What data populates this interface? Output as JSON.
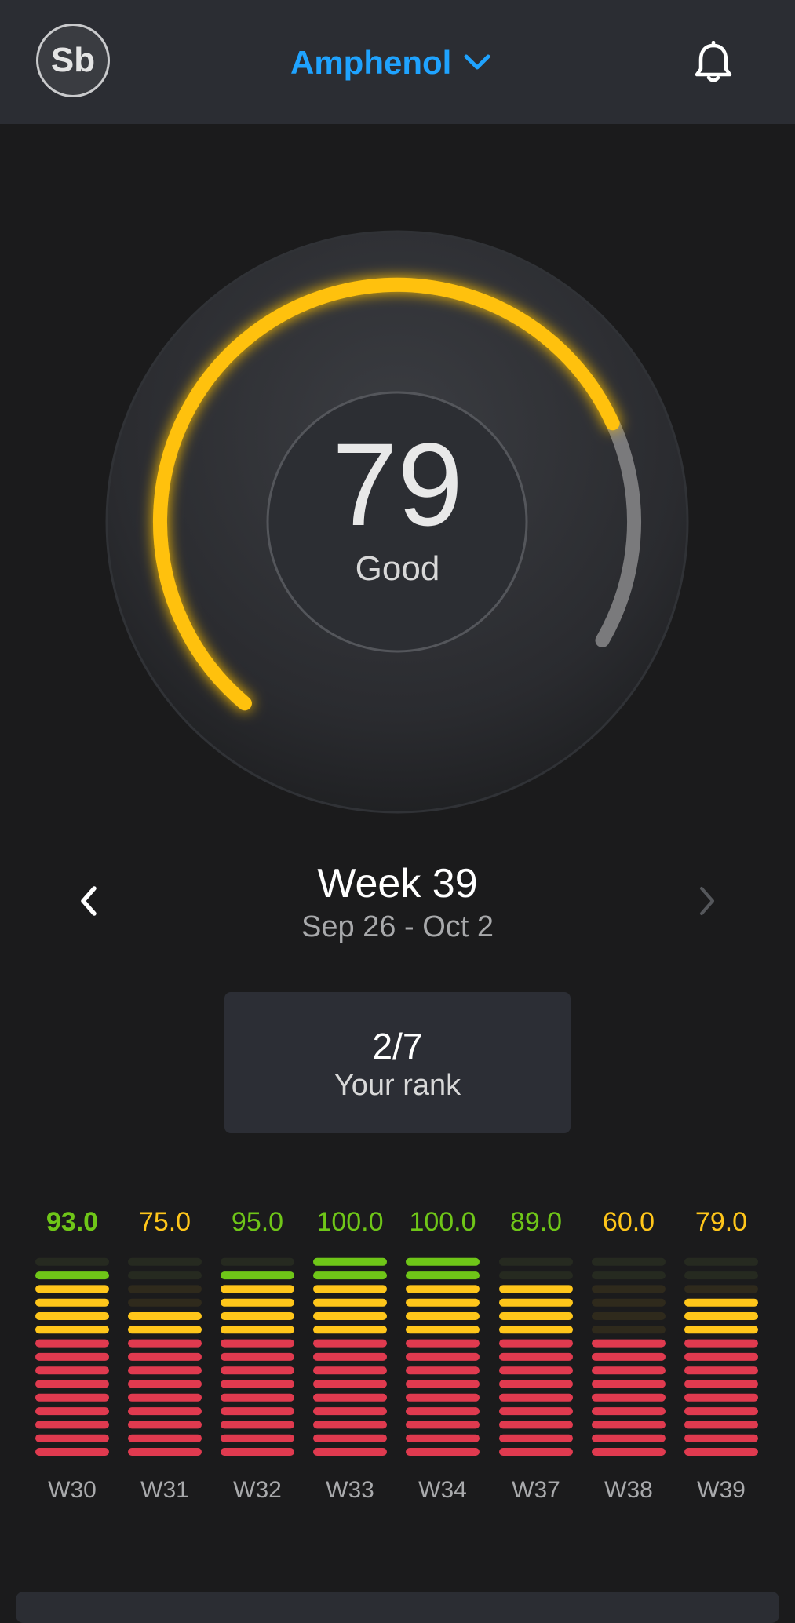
{
  "header": {
    "avatar_initials": "Sb",
    "org_name": "Amphenol",
    "icons": {
      "dropdown": "chevron-down-icon",
      "notifications": "bell-icon"
    },
    "org_color": "#1fa3ff"
  },
  "score": {
    "value": 79,
    "value_text": "79",
    "label": "Good",
    "max": 100,
    "arc_color": "#ffc107"
  },
  "period": {
    "title": "Week 39",
    "range": "Sep 26 - Oct 2"
  },
  "rank": {
    "value": "2/7",
    "label": "Your rank"
  },
  "chart_data": {
    "type": "bar",
    "categories": [
      "W30",
      "W31",
      "W32",
      "W33",
      "W34",
      "W37",
      "W38",
      "W39"
    ],
    "values": [
      93.0,
      75.0,
      95.0,
      100.0,
      100.0,
      89.0,
      60.0,
      79.0
    ],
    "value_labels": [
      "93.0",
      "75.0",
      "95.0",
      "100.0",
      "100.0",
      "89.0",
      "60.0",
      "79.0"
    ],
    "ylim": [
      0,
      100
    ],
    "colors": {
      "green": "#6fc618",
      "yellow": "#ffc61a",
      "red": "#e03a4f",
      "dim_green": "#262a20",
      "dim_yellow": "#2f2a1c"
    }
  }
}
